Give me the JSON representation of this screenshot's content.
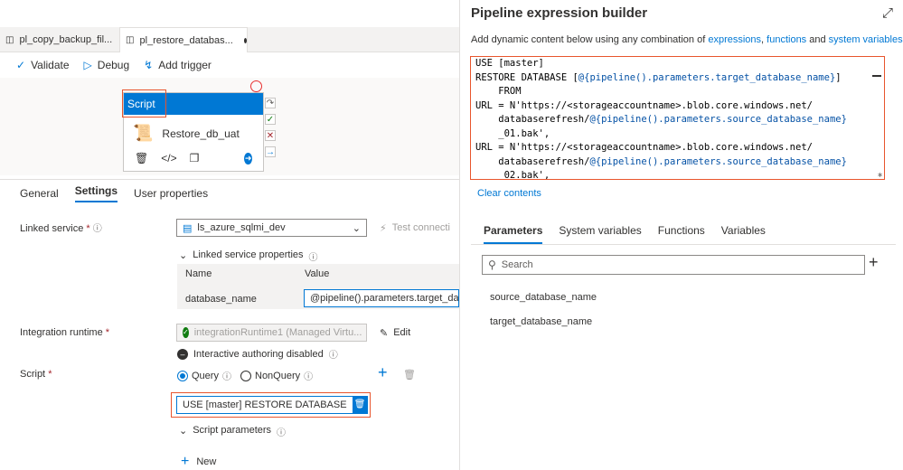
{
  "tabs": [
    {
      "label": "pl_copy_backup_fil..."
    },
    {
      "label": "pl_restore_databas..."
    }
  ],
  "toolbar": {
    "validate": "Validate",
    "debug": "Debug",
    "add_trigger": "Add trigger"
  },
  "activity": {
    "type": "Script",
    "name": "Restore_db_uat"
  },
  "subtabs": [
    "General",
    "Settings",
    "User properties"
  ],
  "settings": {
    "linked_service_label": "Linked service",
    "linked_service_value": "ls_azure_sqlmi_dev",
    "test_connection": "Test connecti",
    "linked_props_label": "Linked service properties",
    "col_name": "Name",
    "col_value": "Value",
    "prop_name": "database_name",
    "prop_value": "@pipeline().parameters.target_dat",
    "ir_label": "Integration runtime",
    "ir_value": "integrationRuntime1 (Managed Virtu...",
    "edit": "Edit",
    "interactive": "Interactive authoring disabled",
    "script_label": "Script",
    "query": "Query",
    "nonquery": "NonQuery",
    "script_value": "USE [master] RESTORE DATABASE [@...",
    "script_params": "Script parameters",
    "new": "New"
  },
  "panel": {
    "title": "Pipeline expression builder",
    "subtitle_pre": "Add dynamic content below using any combination of ",
    "link_expr": "expressions",
    "link_func": "functions",
    "and": " and ",
    "link_sys": "system variables",
    "editor_lines": [
      "USE [master]",
      "RESTORE DATABASE [@{pipeline().parameters.target_database_name}]",
      "    FROM",
      "URL = N'https://<storageaccountname>.blob.core.windows.net/",
      "    databaserefresh/@{pipeline().parameters.source_database_name}",
      "    _01.bak',",
      "URL = N'https://<storageaccountname>.blob.core.windows.net/",
      "    databaserefresh/@{pipeline().parameters.source_database_name}",
      "    _02.bak',"
    ],
    "clear": "Clear contents",
    "tabs": [
      "Parameters",
      "System variables",
      "Functions",
      "Variables"
    ],
    "search_placeholder": "Search",
    "params": [
      "source_database_name",
      "target_database_name"
    ]
  }
}
